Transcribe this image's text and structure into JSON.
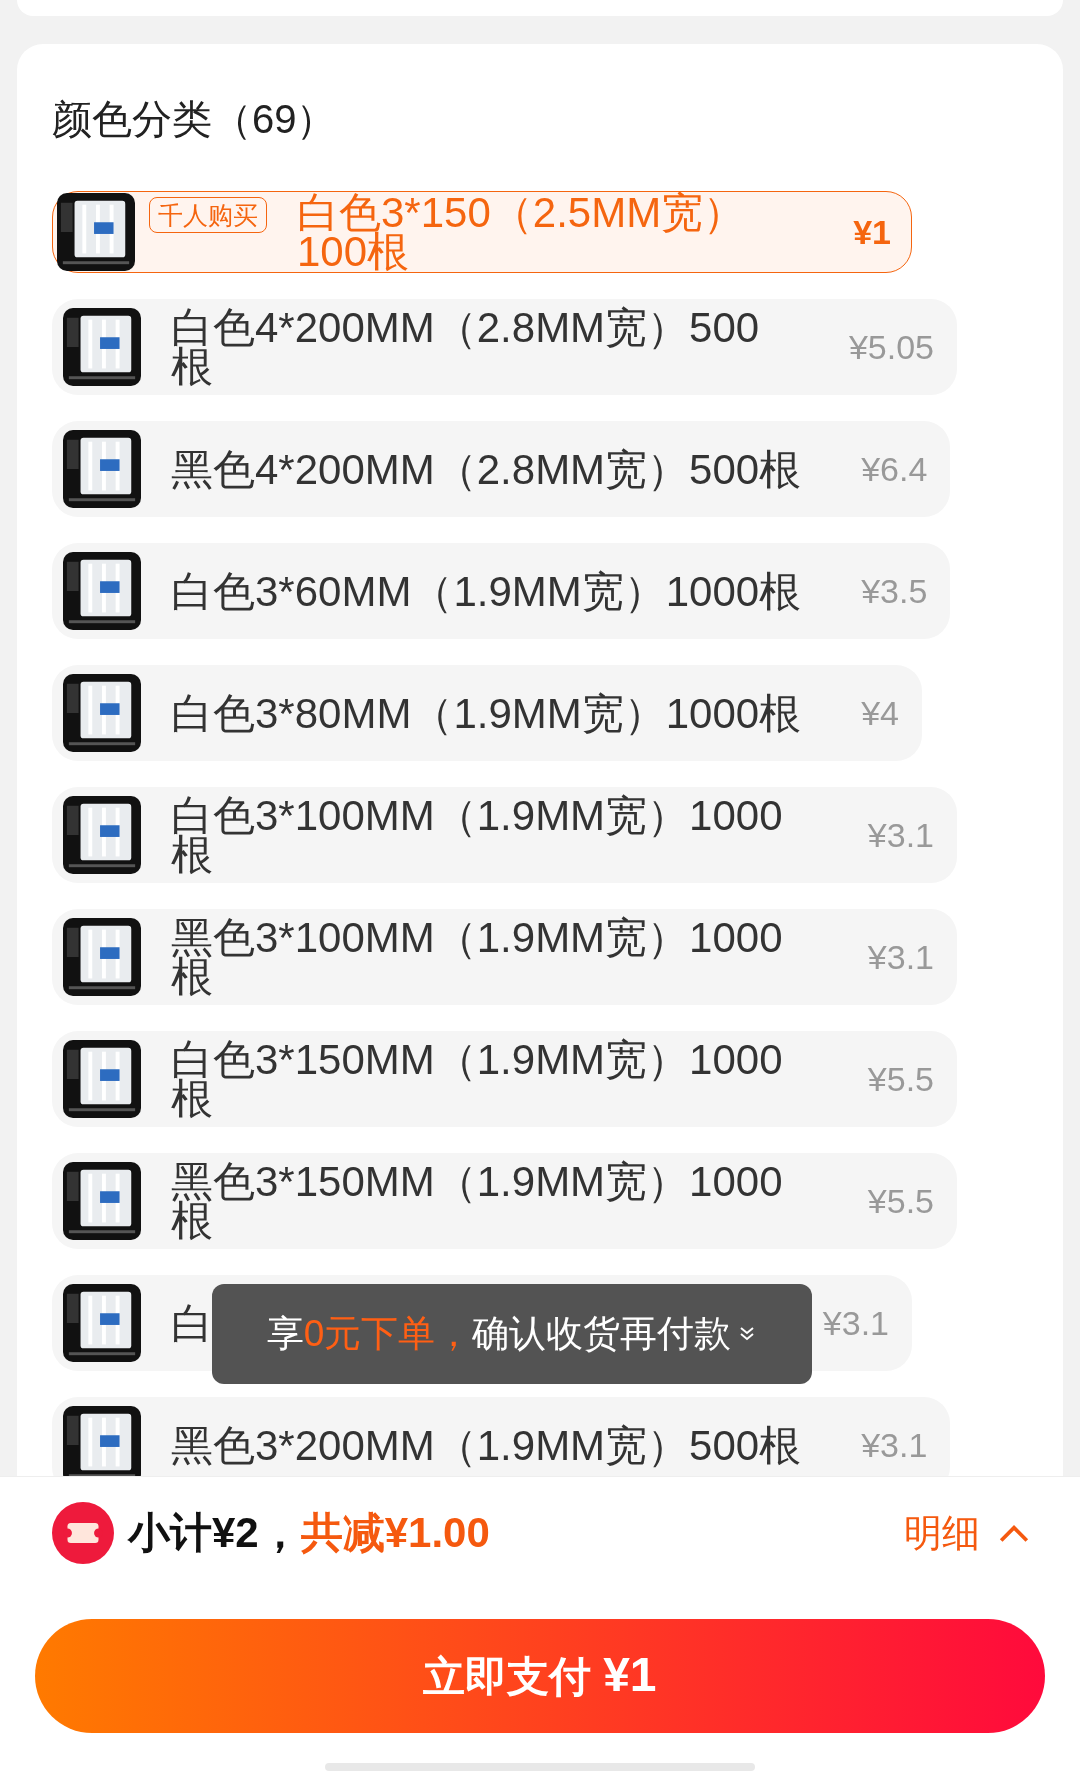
{
  "section": {
    "title": "颜色分类（69）"
  },
  "options": [
    {
      "name": "白色3*150（2.5MM宽）100根",
      "price": "¥1",
      "badge": "千人购买",
      "selected": true
    },
    {
      "name": "白色4*200MM（2.8MM宽）500根",
      "price": "¥5.05",
      "selected": false
    },
    {
      "name": "黑色4*200MM（2.8MM宽）500根",
      "price": "¥6.4",
      "selected": false
    },
    {
      "name": "白色3*60MM（1.9MM宽）1000根",
      "price": "¥3.5",
      "selected": false
    },
    {
      "name": "白色3*80MM（1.9MM宽）1000根",
      "price": "¥4",
      "selected": false
    },
    {
      "name": "白色3*100MM（1.9MM宽）1000根",
      "price": "¥3.1",
      "selected": false
    },
    {
      "name": "黑色3*100MM（1.9MM宽）1000根",
      "price": "¥3.1",
      "selected": false
    },
    {
      "name": "白色3*150MM（1.9MM宽）1000根",
      "price": "¥5.5",
      "selected": false
    },
    {
      "name": "黑色3*150MM（1.9MM宽）1000根",
      "price": "¥5.5",
      "selected": false
    },
    {
      "name": "白",
      "price": "¥3.1",
      "selected": false
    },
    {
      "name": "黑色3*200MM（1.9MM宽）500根",
      "price": "¥3.1",
      "selected": false
    }
  ],
  "toast": {
    "prefix": "享",
    "highlight": "0元下单，",
    "text": "确认收货再付款"
  },
  "summary": {
    "subtotal": "小计¥2，",
    "discount": "共减¥1.00",
    "details": "明细"
  },
  "pay_button": {
    "label": "立即支付",
    "amount": "¥1"
  }
}
